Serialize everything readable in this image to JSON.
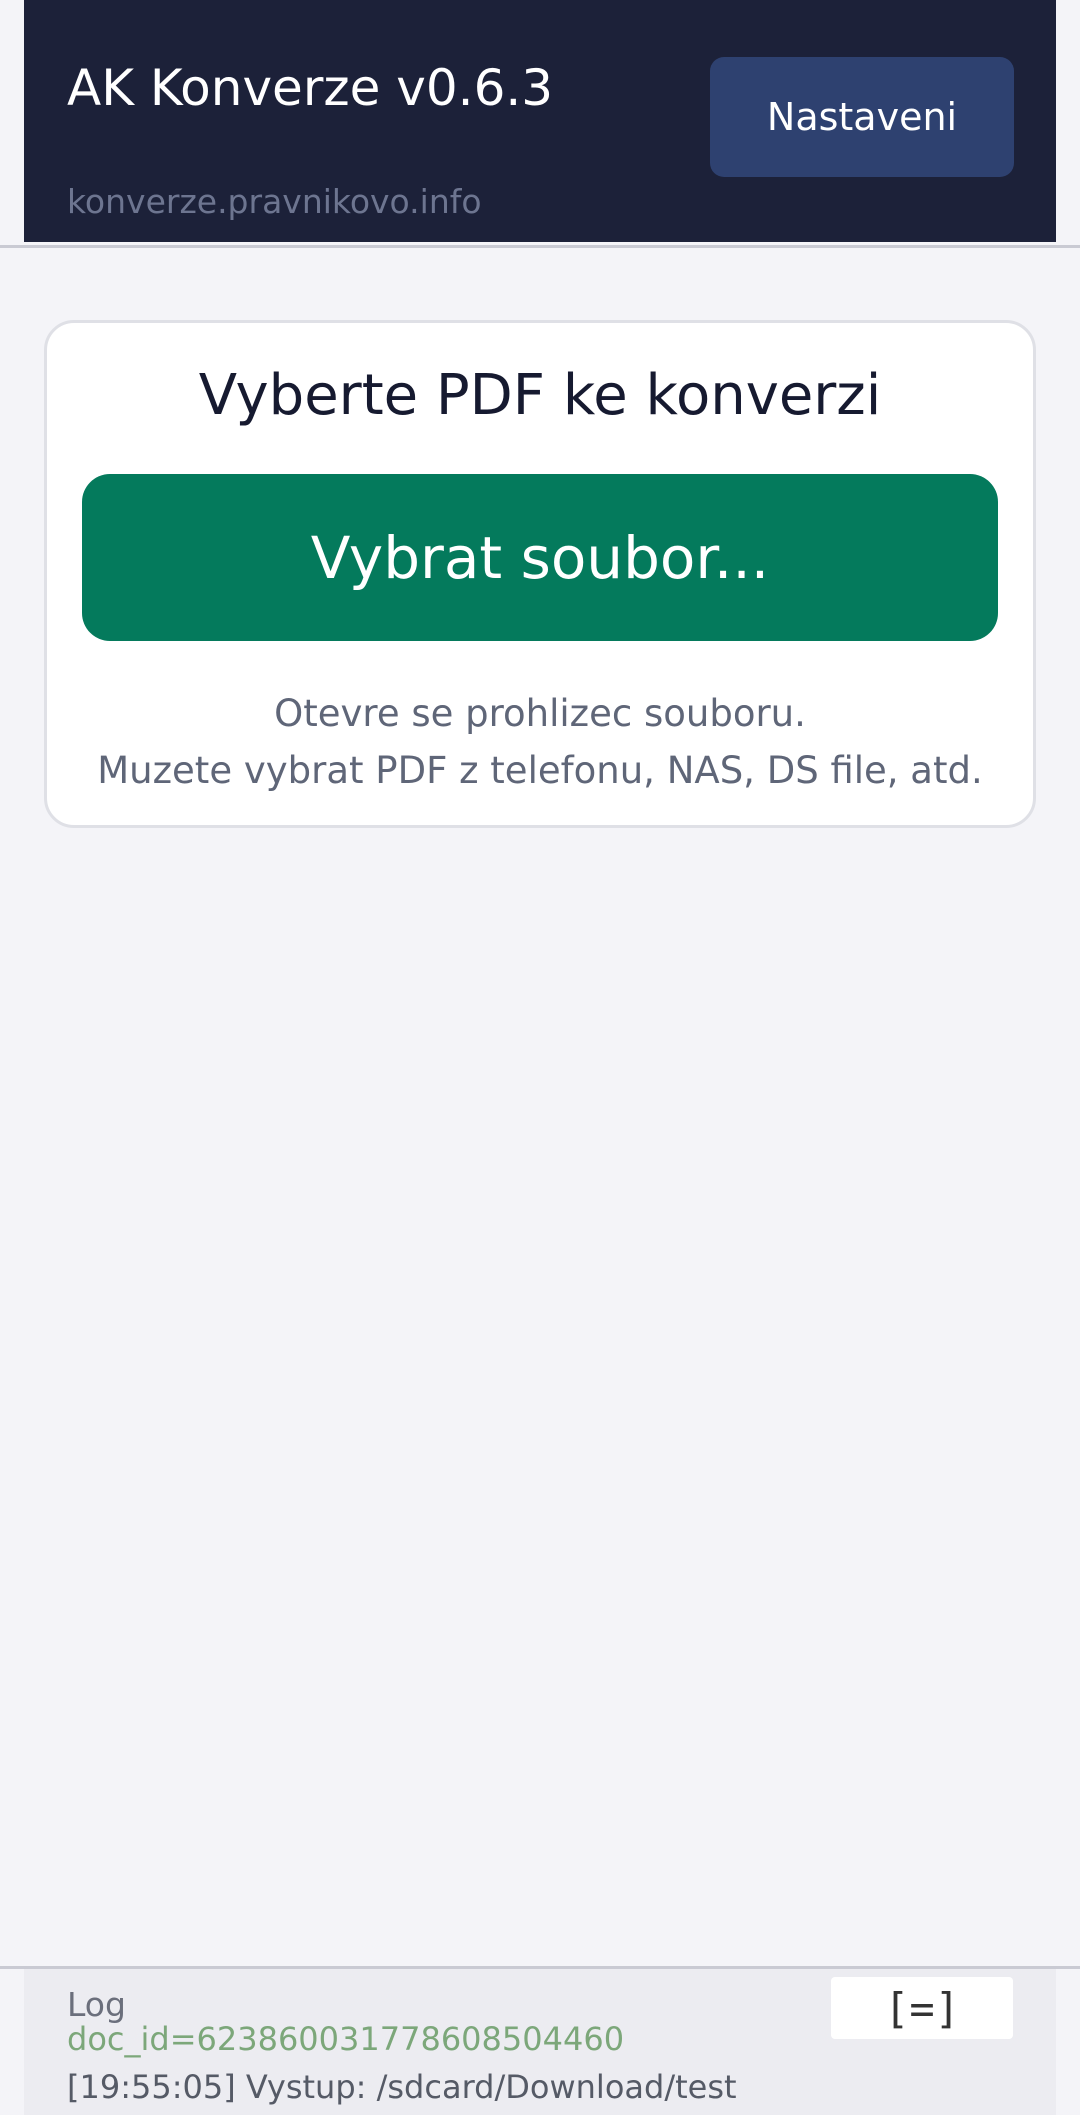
{
  "header": {
    "title": "AK Konverze v0.6.3",
    "subtitle": "konverze.pravnikovo.info",
    "settings_label": "Nastaveni"
  },
  "card": {
    "title": "Vyberte PDF ke konverzi",
    "button_label": "Vybrat soubor...",
    "hint_line1": "Otevre se prohlizec souboru.",
    "hint_line2": "Muzete vybrat PDF z telefonu, NAS, DS file, atd."
  },
  "log": {
    "title": "Log",
    "toggle_label": "[=]",
    "lines": [
      "doc_id=623860031778608504460",
      "[19:55:05] Vystup: /sdcard/Download/test"
    ]
  },
  "colors": {
    "header_bg": "#1c2139",
    "settings_button_bg": "#2e4170",
    "primary_button_bg": "#047a5c",
    "page_bg": "#f4f4f8"
  }
}
